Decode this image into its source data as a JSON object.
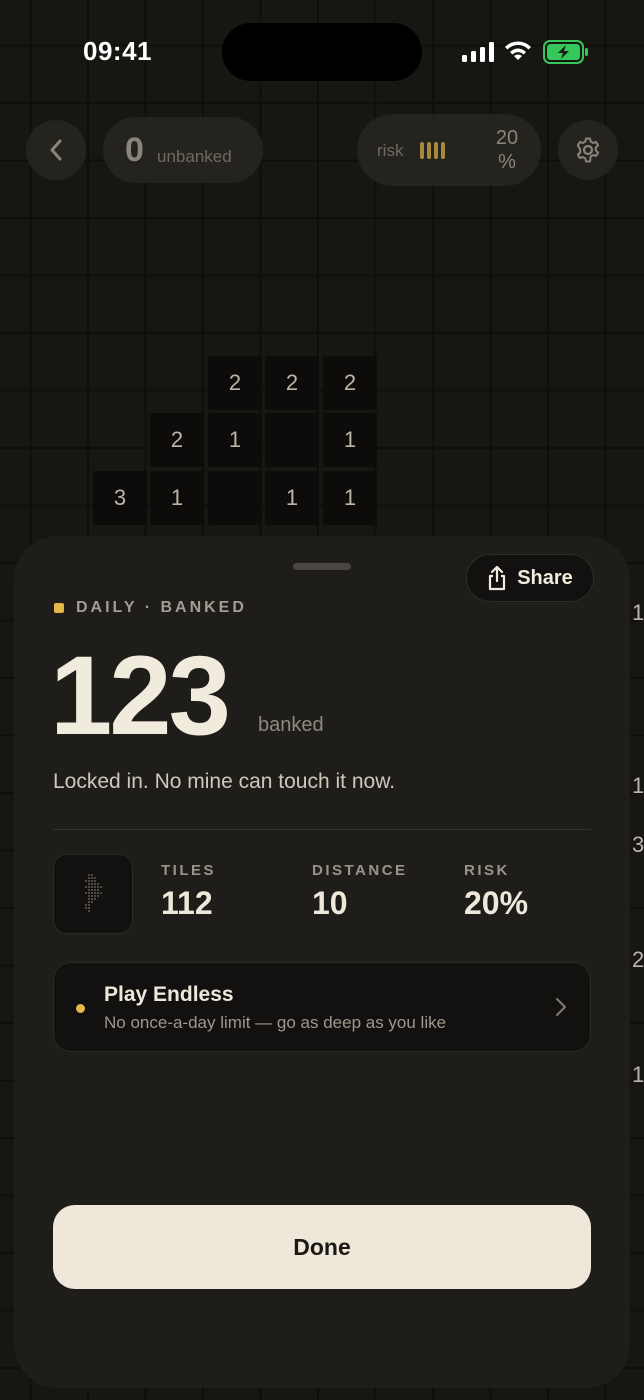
{
  "status_bar": {
    "time": "09:41"
  },
  "top_bar": {
    "score": "0",
    "score_label": "unbanked",
    "risk_label": "risk",
    "risk_value_line1": "20",
    "risk_value_line2": "%"
  },
  "board": {
    "cells": [
      "2",
      "2",
      "2",
      "2",
      "1",
      "",
      "1",
      "3",
      "1",
      "",
      "1",
      "1"
    ],
    "edge_numbers": [
      "1",
      "1",
      "3",
      "2",
      "1"
    ]
  },
  "sheet": {
    "share_label": "Share",
    "kicker": "DAILY · BANKED",
    "score": "123",
    "score_unit": "banked",
    "tagline": "Locked in. No mine can touch it now.",
    "stats": [
      {
        "label": "TILES",
        "value": "112"
      },
      {
        "label": "DISTANCE",
        "value": "10"
      },
      {
        "label": "RISK",
        "value": "20%"
      }
    ],
    "endless": {
      "title": "Play Endless",
      "subtitle": "No once-a-day limit — go as deep as you like"
    },
    "done_label": "Done"
  },
  "colors": {
    "accent": "#e6b84c",
    "sheet_bg": "#1e1d1a",
    "button_bg": "#efe8da",
    "battery_green": "#34c759"
  }
}
